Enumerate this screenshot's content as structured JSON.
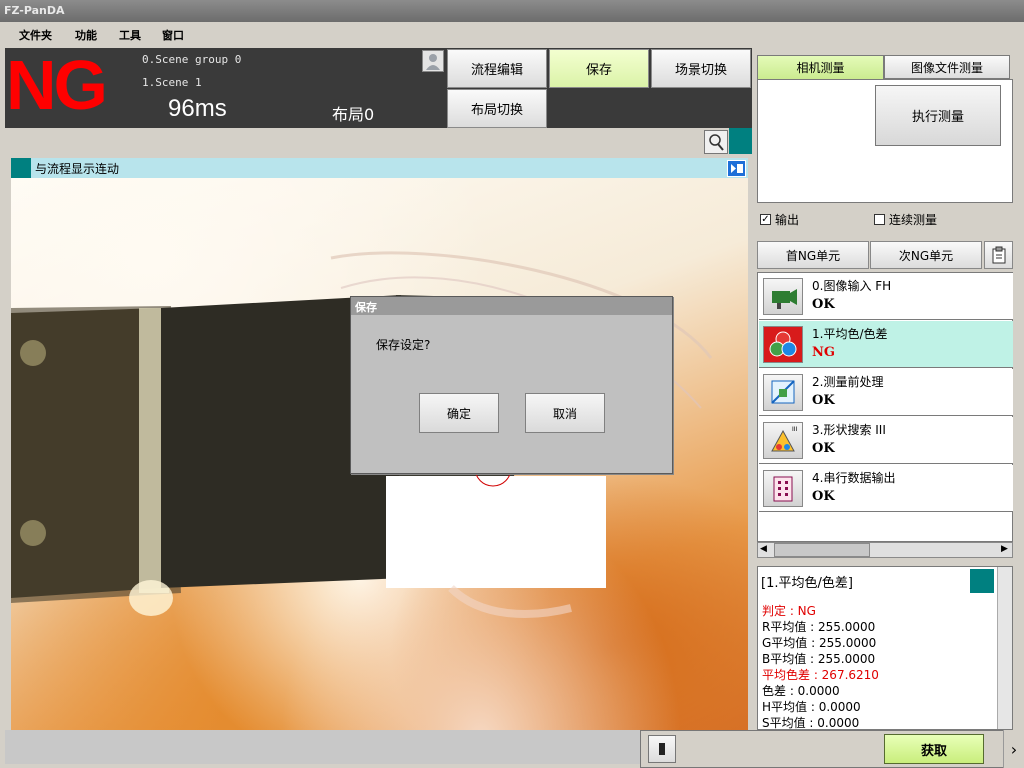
{
  "window": {
    "title": "FZ-PanDA"
  },
  "menu": [
    "文件夹",
    "功能",
    "工具",
    "窗口"
  ],
  "status": {
    "judgement": "NG",
    "scene_group": "0.Scene group 0",
    "scene": "1.Scene 1",
    "time": "96ms",
    "layout": "布局0"
  },
  "toolbar": {
    "flow_edit": "流程编辑",
    "save": "保存",
    "scene_switch": "场景切换",
    "layout_switch": "布局切换"
  },
  "image_window": {
    "link_label": "与流程显示连动"
  },
  "dialog": {
    "title": "保存",
    "message": "保存设定?",
    "ok": "确定",
    "cancel": "取消"
  },
  "measure": {
    "tabs": [
      "相机测量",
      "图像文件测量"
    ],
    "run_button": "执行测量",
    "output_label": "输出",
    "output_checked": true,
    "continuous_label": "连续测量",
    "continuous_checked": false
  },
  "flow_nav": {
    "first_ng": "首NG单元",
    "next_ng": "次NG单元"
  },
  "flow_units": [
    {
      "name": "0.图像输入 FH",
      "result": "OK",
      "icon": "camera-input-icon"
    },
    {
      "name": "1.平均色/色差",
      "result": "NG",
      "icon": "color-average-icon",
      "selected": true
    },
    {
      "name": "2.测量前处理",
      "result": "OK",
      "icon": "preprocess-icon"
    },
    {
      "name": "3.形状搜索 III",
      "result": "OK",
      "icon": "shape-search-icon"
    },
    {
      "name": "4.串行数据输出",
      "result": "OK",
      "icon": "serial-output-icon"
    }
  ],
  "detail": {
    "title": "[1.平均色/色差]",
    "lines": [
      {
        "text": "判定 : NG",
        "red": true
      },
      {
        "text": "R平均值 : 255.0000",
        "red": false
      },
      {
        "text": "G平均值 : 255.0000",
        "red": false
      },
      {
        "text": "B平均值 : 255.0000",
        "red": false
      },
      {
        "text": "平均色差 : 267.6210",
        "red": true
      },
      {
        "text": "色差 : 0.0000",
        "red": false
      },
      {
        "text": "H平均值 : 0.0000",
        "red": false
      },
      {
        "text": "S平均值 : 0.0000",
        "red": false
      }
    ]
  },
  "acquire": {
    "label": "获取"
  },
  "colors": {
    "ng": "#ff0000",
    "accent_green": "#c9ee7c",
    "teal": "#008080",
    "selected_row": "#bff2e6"
  }
}
